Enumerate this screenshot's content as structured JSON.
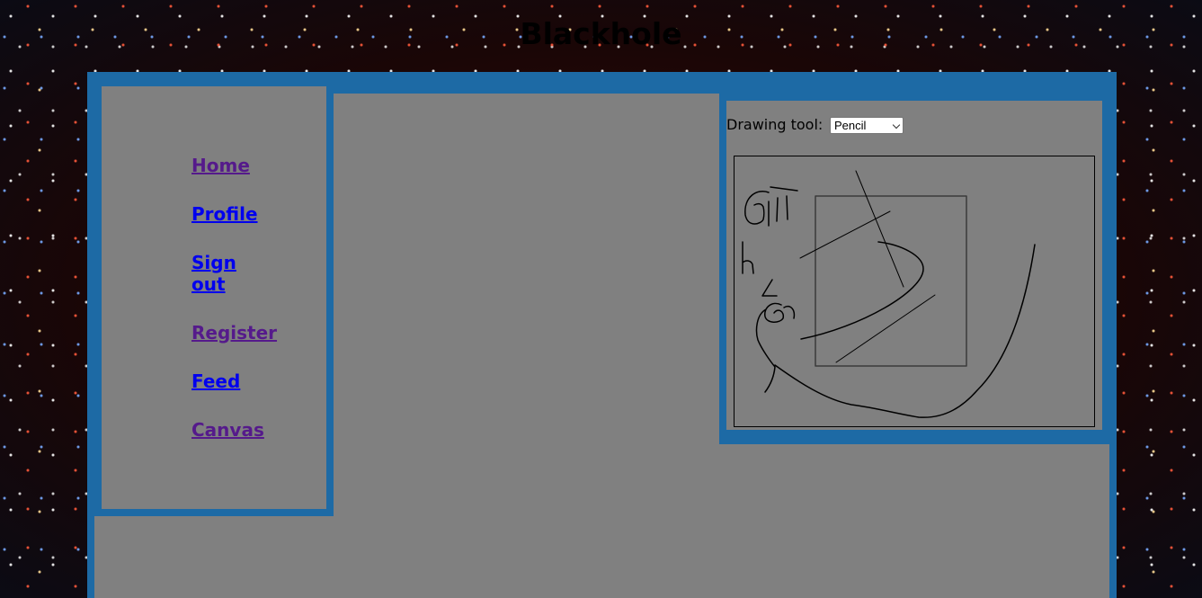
{
  "site": {
    "title": "Blackhole"
  },
  "nav": {
    "items": [
      {
        "label": "Home",
        "state": "visited"
      },
      {
        "label": "Profile",
        "state": "link"
      },
      {
        "label": "Sign out",
        "state": "link"
      },
      {
        "label": "Register",
        "state": "visited"
      },
      {
        "label": "Feed",
        "state": "link"
      },
      {
        "label": "Canvas",
        "state": "visited"
      }
    ]
  },
  "toolbar": {
    "label": "Drawing tool:",
    "selected_tool": "Pencil"
  },
  "colors": {
    "frame": "#1d6aa5",
    "panel": "#808080",
    "link": "#0000ee",
    "visited_link": "#551a8b"
  }
}
